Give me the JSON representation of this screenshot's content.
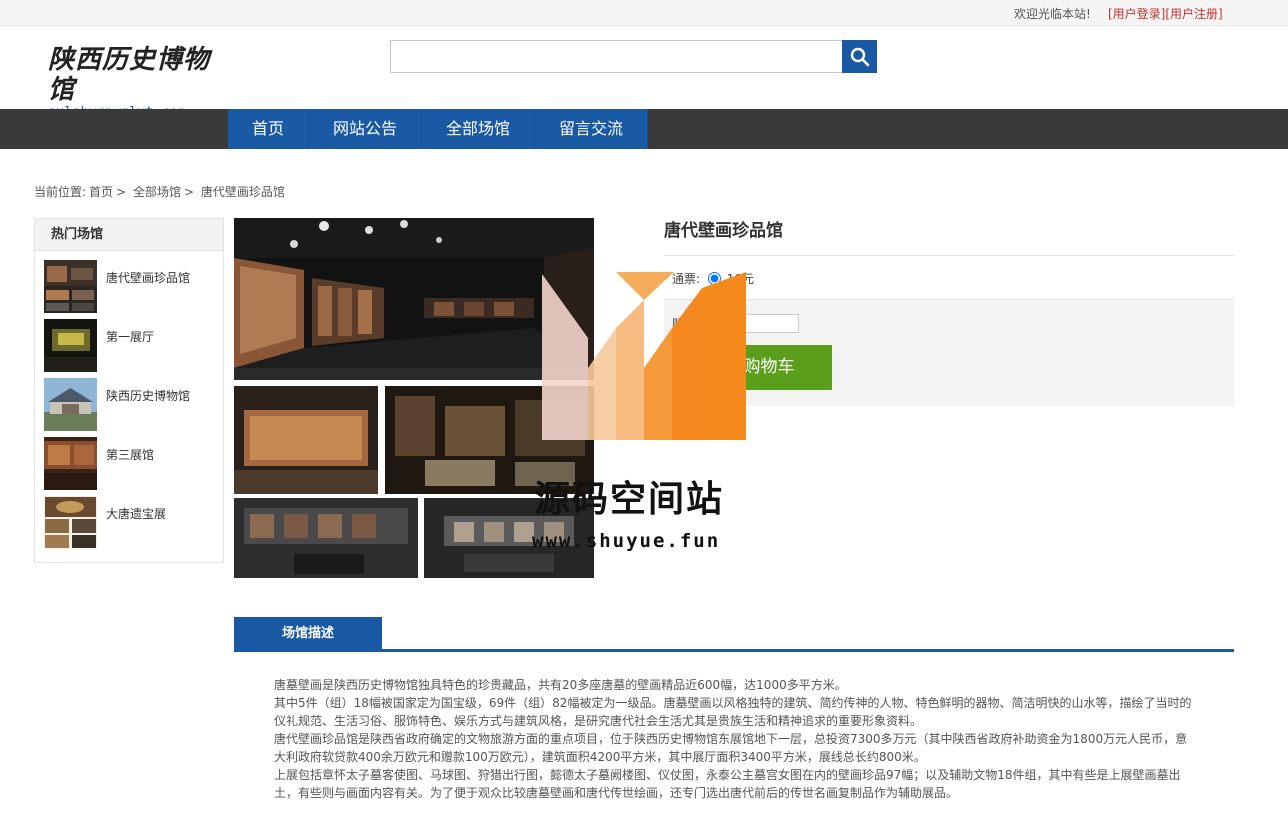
{
  "topbar": {
    "welcome": "欢迎光临本站!",
    "login": "[用户登录]",
    "register": "[用户注册]"
  },
  "logo": {
    "cn": "陕西历史博物馆",
    "en": "sxlsbwgpwglxt.com"
  },
  "search": {
    "value": "",
    "icon": "search-icon"
  },
  "nav": {
    "items": [
      {
        "label": "首页"
      },
      {
        "label": "网站公告"
      },
      {
        "label": "全部场馆"
      },
      {
        "label": "留言交流"
      }
    ]
  },
  "breadcrumb": {
    "prefix": "当前位置:",
    "home": "首页",
    "sep": ">",
    "level1": "全部场馆",
    "current": "唐代壁画珍品馆"
  },
  "sidebar": {
    "title": "热门场馆",
    "items": [
      {
        "label": "唐代壁画珍品馆"
      },
      {
        "label": "第一展厅"
      },
      {
        "label": "陕西历史博物馆"
      },
      {
        "label": "第三展馆"
      },
      {
        "label": "大唐遗宝展"
      }
    ]
  },
  "product": {
    "name": "唐代壁画珍品馆",
    "ticket_label": "通票:",
    "ticket_option": "10元",
    "qty_label": "购买数量",
    "qty_value": "",
    "cart_button": "加入购物车"
  },
  "watermark": {
    "title": "源码空间站",
    "url": "www.shuyue.fun"
  },
  "tabs": {
    "active": "场馆描述"
  },
  "description": [
    "唐墓壁画是陕西历史博物馆独具特色的珍贵藏品，共有20多座唐墓的壁画精品近600幅，达1000多平方米。",
    "其中5件（组）18幅被国家定为国宝级，69件（组）82幅被定为一级品。唐墓壁画以风格独特的建筑、简约传神的人物、特色鲜明的器物、简洁明快的山水等，描绘了当时的仪礼规范、生活习俗、服饰特色、娱乐方式与建筑风格，是研究唐代社会生活尤其是贵族生活和精神追求的重要形象资料。",
    "唐代壁画珍品馆是陕西省政府确定的文物旅游方面的重点项目，位于陕西历史博物馆东展馆地下一层，总投资7300多万元（其中陕西省政府补助资金为1800万元人民币，意大利政府软贷款400余万欧元和赠款100万欧元），建筑面积4200平方米，其中展厅面积3400平方米，展线总长约800米。",
    "上展包括章怀太子墓客使图、马球图、狩猎出行图，懿德太子墓阙楼图、仪仗图，永泰公主墓宫女图在内的壁画珍品97幅；以及辅助文物18件组，其中有些是上展壁画墓出土，有些则与画面内容有关。为了便于观众比较唐墓壁画和唐代传世绘画，还专门选出唐代前后的传世名画复制品作为辅助展品。"
  ],
  "colors": {
    "brand_blue": "#1a5aa5",
    "nav_dark": "#3a3a3a",
    "cart_green": "#5a9e1b",
    "link_red": "#c9302c",
    "watermark_orange": "#f5891f"
  }
}
